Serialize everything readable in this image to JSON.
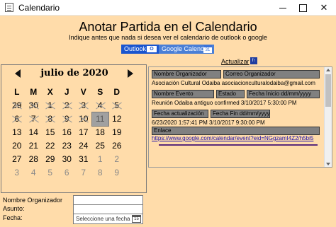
{
  "window": {
    "title": "Calendario"
  },
  "header": {
    "title": "Anotar Partida en el Calendario",
    "subtitle": "Indique antes que nada si desea ver el calendario de outlook o google"
  },
  "services": {
    "outlook_label": "Outlook",
    "outlook_icon_text": "O",
    "google_label": "Google Calendar",
    "google_icon_text": "31"
  },
  "actualizar": {
    "label": "Actualizar",
    "icon_text": "f↑"
  },
  "calendar": {
    "month_label": "julio de 2020",
    "weekdays": [
      "L",
      "M",
      "X",
      "J",
      "V",
      "S",
      "D"
    ],
    "days": [
      {
        "t": "29",
        "other": false,
        "blackout": true
      },
      {
        "t": "30",
        "other": false,
        "blackout": true
      },
      {
        "t": "1",
        "other": false,
        "blackout": true
      },
      {
        "t": "2",
        "other": false,
        "blackout": true
      },
      {
        "t": "3",
        "other": false,
        "blackout": true
      },
      {
        "t": "4",
        "other": false,
        "blackout": true
      },
      {
        "t": "5",
        "other": false,
        "blackout": true
      },
      {
        "t": "6",
        "other": false,
        "blackout": true
      },
      {
        "t": "7",
        "other": false,
        "blackout": true
      },
      {
        "t": "8",
        "other": false,
        "blackout": true
      },
      {
        "t": "9",
        "other": false,
        "blackout": true
      },
      {
        "t": "10",
        "other": false,
        "blackout": true
      },
      {
        "t": "11",
        "other": false,
        "today": true
      },
      {
        "t": "12"
      },
      {
        "t": "13"
      },
      {
        "t": "14"
      },
      {
        "t": "15"
      },
      {
        "t": "16"
      },
      {
        "t": "17"
      },
      {
        "t": "18"
      },
      {
        "t": "19"
      },
      {
        "t": "20"
      },
      {
        "t": "21"
      },
      {
        "t": "22"
      },
      {
        "t": "23"
      },
      {
        "t": "24"
      },
      {
        "t": "25"
      },
      {
        "t": "26"
      },
      {
        "t": "27"
      },
      {
        "t": "28"
      },
      {
        "t": "29"
      },
      {
        "t": "30"
      },
      {
        "t": "31"
      },
      {
        "t": "1",
        "other": true
      },
      {
        "t": "2",
        "other": true
      },
      {
        "t": "3",
        "other": true
      },
      {
        "t": "4",
        "other": true
      },
      {
        "t": "5",
        "other": true
      },
      {
        "t": "6",
        "other": true
      },
      {
        "t": "7",
        "other": true
      },
      {
        "t": "8",
        "other": true
      },
      {
        "t": "9",
        "other": true
      }
    ]
  },
  "event": {
    "organizador_label": "Nombre Organizador",
    "correo_label": "Correo Organizador",
    "organizador_value": "Asociación Cultural Odaiba asociacionculturalodaiba@gmail.com",
    "evento_label": "Nombre Evento",
    "estado_label": "Estado",
    "inicio_label": "Fecha Inicio dd/mm/yyyy",
    "evento_value": "Reunión Odaiba antiguo confirmed 3/10/2017 5:30:00 PM",
    "actualizacion_label": "Fecha actualización",
    "fin_label": "Fecha Fin dd/mm/yyyy",
    "fechas_value": "6/23/2020 1:57:41 PM  3/10/2017 9:30:00 PM",
    "enlace_label": "Enlace",
    "enlace_value": "https://www.google.com/calendar/event?eid=NGgzamI4Z2/h5bi5"
  },
  "form": {
    "organizador_label": "Nombre Organizador",
    "asunto_label": "Asunto:",
    "fecha_label": "Fecha:",
    "fecha_placeholder": "Seleccione una fecha",
    "fecha_icon_text": "15"
  }
}
